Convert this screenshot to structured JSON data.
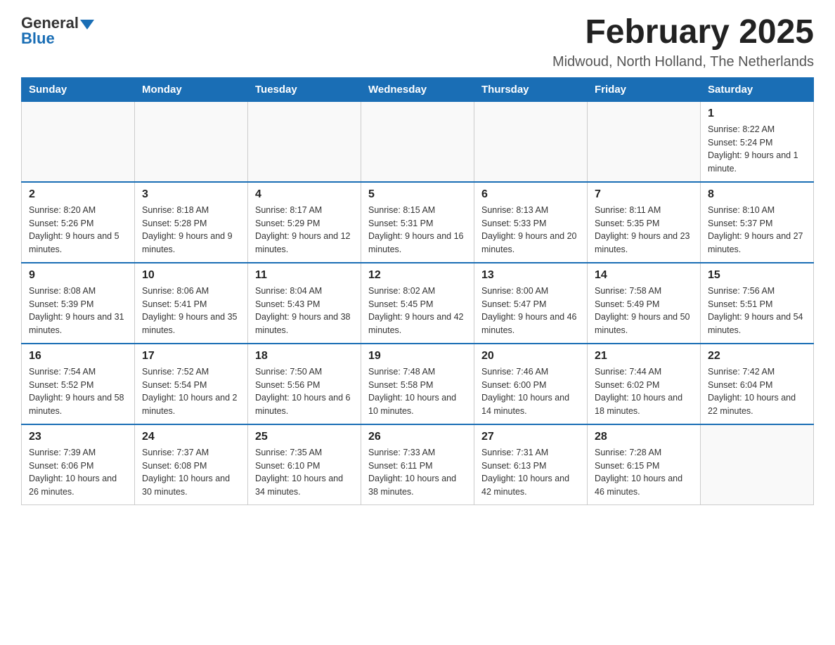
{
  "logo": {
    "general": "General",
    "blue": "Blue"
  },
  "header": {
    "month_year": "February 2025",
    "location": "Midwoud, North Holland, The Netherlands"
  },
  "weekdays": [
    "Sunday",
    "Monday",
    "Tuesday",
    "Wednesday",
    "Thursday",
    "Friday",
    "Saturday"
  ],
  "weeks": [
    [
      {
        "day": "",
        "info": ""
      },
      {
        "day": "",
        "info": ""
      },
      {
        "day": "",
        "info": ""
      },
      {
        "day": "",
        "info": ""
      },
      {
        "day": "",
        "info": ""
      },
      {
        "day": "",
        "info": ""
      },
      {
        "day": "1",
        "info": "Sunrise: 8:22 AM\nSunset: 5:24 PM\nDaylight: 9 hours and 1 minute."
      }
    ],
    [
      {
        "day": "2",
        "info": "Sunrise: 8:20 AM\nSunset: 5:26 PM\nDaylight: 9 hours and 5 minutes."
      },
      {
        "day": "3",
        "info": "Sunrise: 8:18 AM\nSunset: 5:28 PM\nDaylight: 9 hours and 9 minutes."
      },
      {
        "day": "4",
        "info": "Sunrise: 8:17 AM\nSunset: 5:29 PM\nDaylight: 9 hours and 12 minutes."
      },
      {
        "day": "5",
        "info": "Sunrise: 8:15 AM\nSunset: 5:31 PM\nDaylight: 9 hours and 16 minutes."
      },
      {
        "day": "6",
        "info": "Sunrise: 8:13 AM\nSunset: 5:33 PM\nDaylight: 9 hours and 20 minutes."
      },
      {
        "day": "7",
        "info": "Sunrise: 8:11 AM\nSunset: 5:35 PM\nDaylight: 9 hours and 23 minutes."
      },
      {
        "day": "8",
        "info": "Sunrise: 8:10 AM\nSunset: 5:37 PM\nDaylight: 9 hours and 27 minutes."
      }
    ],
    [
      {
        "day": "9",
        "info": "Sunrise: 8:08 AM\nSunset: 5:39 PM\nDaylight: 9 hours and 31 minutes."
      },
      {
        "day": "10",
        "info": "Sunrise: 8:06 AM\nSunset: 5:41 PM\nDaylight: 9 hours and 35 minutes."
      },
      {
        "day": "11",
        "info": "Sunrise: 8:04 AM\nSunset: 5:43 PM\nDaylight: 9 hours and 38 minutes."
      },
      {
        "day": "12",
        "info": "Sunrise: 8:02 AM\nSunset: 5:45 PM\nDaylight: 9 hours and 42 minutes."
      },
      {
        "day": "13",
        "info": "Sunrise: 8:00 AM\nSunset: 5:47 PM\nDaylight: 9 hours and 46 minutes."
      },
      {
        "day": "14",
        "info": "Sunrise: 7:58 AM\nSunset: 5:49 PM\nDaylight: 9 hours and 50 minutes."
      },
      {
        "day": "15",
        "info": "Sunrise: 7:56 AM\nSunset: 5:51 PM\nDaylight: 9 hours and 54 minutes."
      }
    ],
    [
      {
        "day": "16",
        "info": "Sunrise: 7:54 AM\nSunset: 5:52 PM\nDaylight: 9 hours and 58 minutes."
      },
      {
        "day": "17",
        "info": "Sunrise: 7:52 AM\nSunset: 5:54 PM\nDaylight: 10 hours and 2 minutes."
      },
      {
        "day": "18",
        "info": "Sunrise: 7:50 AM\nSunset: 5:56 PM\nDaylight: 10 hours and 6 minutes."
      },
      {
        "day": "19",
        "info": "Sunrise: 7:48 AM\nSunset: 5:58 PM\nDaylight: 10 hours and 10 minutes."
      },
      {
        "day": "20",
        "info": "Sunrise: 7:46 AM\nSunset: 6:00 PM\nDaylight: 10 hours and 14 minutes."
      },
      {
        "day": "21",
        "info": "Sunrise: 7:44 AM\nSunset: 6:02 PM\nDaylight: 10 hours and 18 minutes."
      },
      {
        "day": "22",
        "info": "Sunrise: 7:42 AM\nSunset: 6:04 PM\nDaylight: 10 hours and 22 minutes."
      }
    ],
    [
      {
        "day": "23",
        "info": "Sunrise: 7:39 AM\nSunset: 6:06 PM\nDaylight: 10 hours and 26 minutes."
      },
      {
        "day": "24",
        "info": "Sunrise: 7:37 AM\nSunset: 6:08 PM\nDaylight: 10 hours and 30 minutes."
      },
      {
        "day": "25",
        "info": "Sunrise: 7:35 AM\nSunset: 6:10 PM\nDaylight: 10 hours and 34 minutes."
      },
      {
        "day": "26",
        "info": "Sunrise: 7:33 AM\nSunset: 6:11 PM\nDaylight: 10 hours and 38 minutes."
      },
      {
        "day": "27",
        "info": "Sunrise: 7:31 AM\nSunset: 6:13 PM\nDaylight: 10 hours and 42 minutes."
      },
      {
        "day": "28",
        "info": "Sunrise: 7:28 AM\nSunset: 6:15 PM\nDaylight: 10 hours and 46 minutes."
      },
      {
        "day": "",
        "info": ""
      }
    ]
  ]
}
